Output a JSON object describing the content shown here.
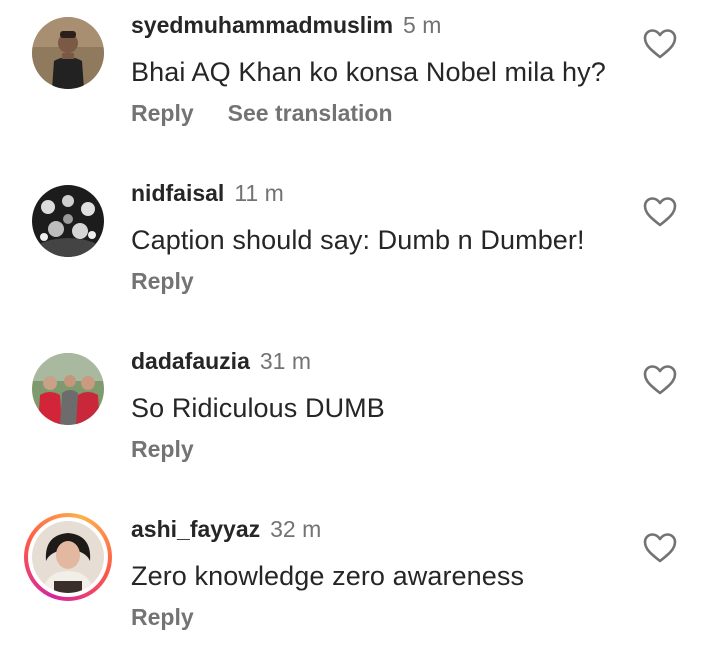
{
  "comments": [
    {
      "username": "syedmuhammadmuslim",
      "time": "5 m",
      "text": "Bhai AQ Khan ko konsa Nobel mila hy?",
      "reply_label": "Reply",
      "translate_label": "See translation",
      "avatar_bg": "#b9a48a"
    },
    {
      "username": "nidfaisal",
      "time": "11 m",
      "text": "Caption should say: Dumb n Dumber!",
      "reply_label": "Reply",
      "avatar_bg": "#2b2b2b"
    },
    {
      "username": "dadafauzia",
      "time": "31 m",
      "text": "So Ridiculous  DUMB",
      "reply_label": "Reply",
      "avatar_bg": "#6b8a5a"
    },
    {
      "username": "ashi_fayyaz",
      "time": "32 m",
      "text": "Zero knowledge zero awareness",
      "reply_label": "Reply",
      "avatar_bg": "#d9cfc6"
    }
  ],
  "icons": {
    "like": "heart-outline-icon"
  },
  "colors": {
    "username": "#262626",
    "meta": "#737373",
    "text": "#262626"
  }
}
